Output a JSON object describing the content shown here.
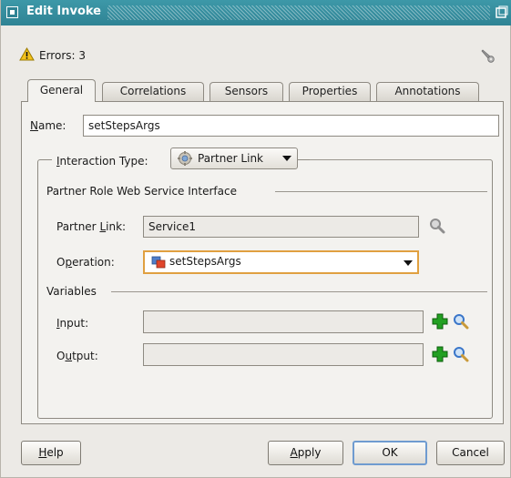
{
  "window": {
    "title": "Edit Invoke"
  },
  "errors": {
    "label": "Errors: 3"
  },
  "tabs": [
    {
      "label": "General",
      "active": true
    },
    {
      "label": "Correlations",
      "active": false
    },
    {
      "label": "Sensors",
      "active": false
    },
    {
      "label": "Properties",
      "active": false
    },
    {
      "label": "Annotations",
      "active": false
    }
  ],
  "general": {
    "name_label": "Name:",
    "name_value": "setStepsArgs",
    "interaction_type_label": "Interaction Type:",
    "interaction_type_value": "Partner Link",
    "partner_role_section": "Partner Role Web Service Interface",
    "partner_link_label": "Partner Link:",
    "partner_link_value": "Service1",
    "operation_label": "Operation:",
    "operation_value": "setStepsArgs",
    "variables_section": "Variables",
    "input_label": "Input:",
    "input_value": "",
    "output_label": "Output:",
    "output_value": ""
  },
  "buttons": {
    "help": "Help",
    "apply": "Apply",
    "ok": "OK",
    "cancel": "Cancel"
  },
  "colors": {
    "titlebar": "#3b94a4",
    "accent_focus": "#e0a040",
    "add_icon": "#1a9a1a",
    "search_icon": "#3a76c9"
  },
  "icons": [
    "window-menu-icon",
    "maximize-icon",
    "warning-icon",
    "wrench-icon",
    "partner-link-icon",
    "operation-icon",
    "search-icon",
    "add-icon"
  ]
}
